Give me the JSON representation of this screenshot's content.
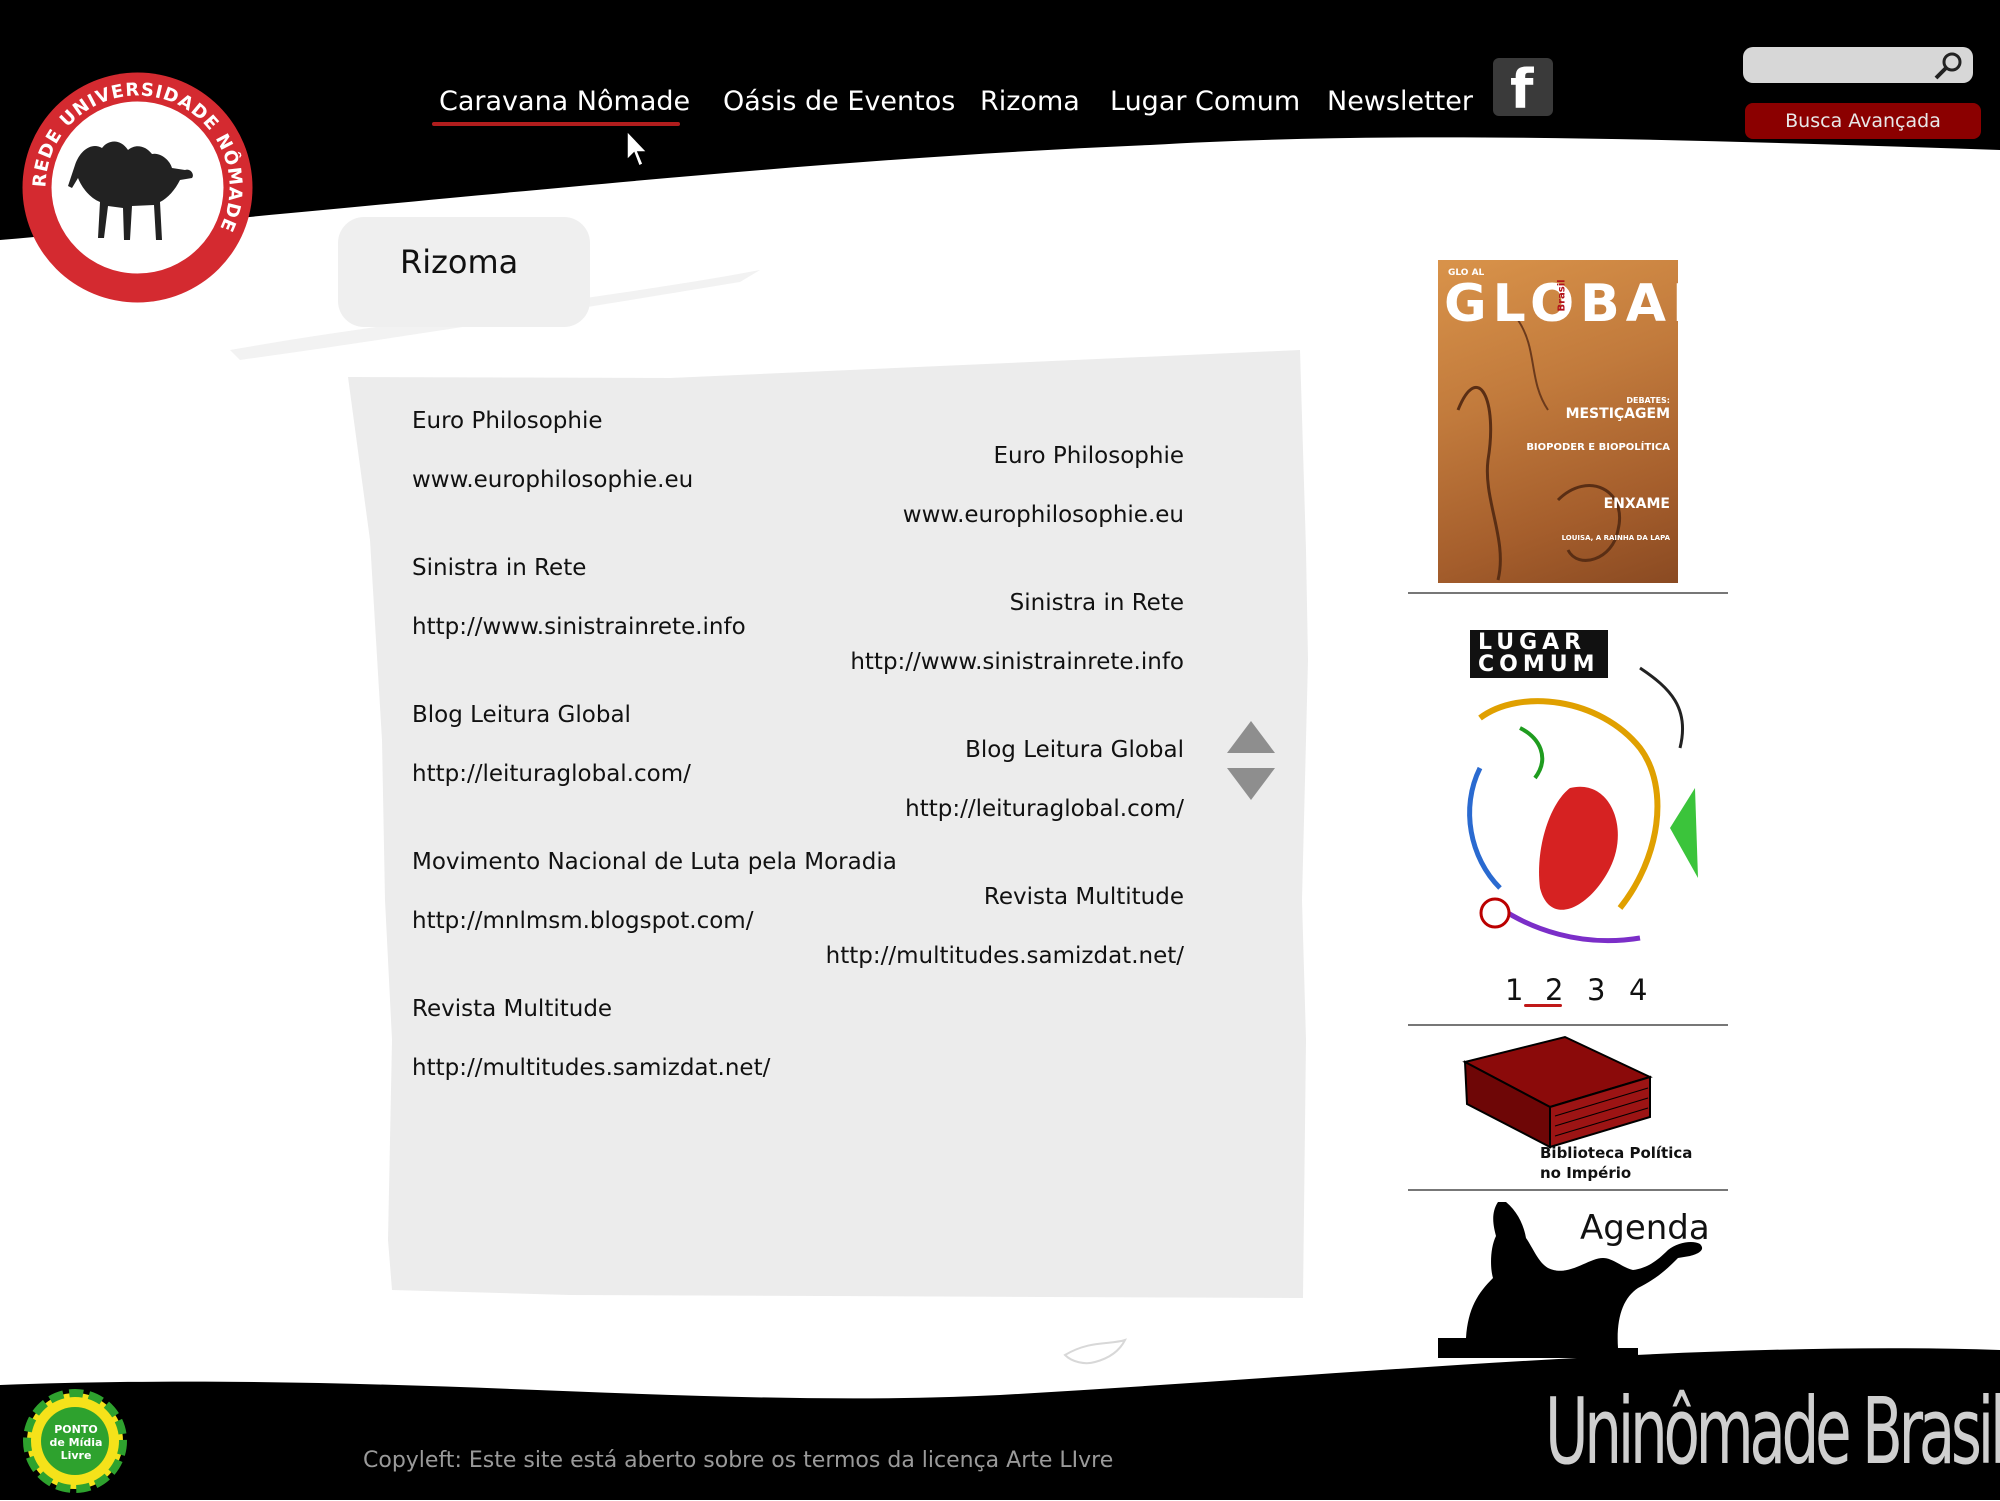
{
  "logo": {
    "ring_text": "REDE UNIVERSIDADE NÔMADE"
  },
  "nav": {
    "items": [
      "Caravana Nômade",
      "Oásis de Eventos",
      "Rizoma",
      "Lugar Comum",
      "Newsletter"
    ],
    "active": "Caravana Nômade",
    "facebook_label": "f"
  },
  "search": {
    "placeholder": "",
    "advanced_label": "Busca Avançada"
  },
  "section": {
    "title": "Rizoma"
  },
  "links_left": [
    {
      "name": "Euro Philosophie",
      "url": "www.europhilosophie.eu"
    },
    {
      "name": "Sinistra in Rete",
      "url": "http://www.sinistrainrete.info"
    },
    {
      "name": "Blog Leitura Global",
      "url": "http://leituraglobal.com/"
    },
    {
      "name": "Movimento Nacional de Luta pela Moradia",
      "url": "http://mnlmsm.blogspot.com/"
    },
    {
      "name": "Revista Multitude",
      "url": "http://multitudes.samizdat.net/"
    }
  ],
  "links_right": [
    {
      "name": "Euro Philosophie",
      "url": "www.europhilosophie.eu"
    },
    {
      "name": "Sinistra in Rete",
      "url": "http://www.sinistrainrete.info"
    },
    {
      "name": "Blog Leitura Global",
      "url": "http://leituraglobal.com/"
    },
    {
      "name": "Revista Multitude",
      "url": "http://multitudes.samizdat.net/"
    }
  ],
  "sidebar": {
    "global_cover": {
      "small_title": "GLO AL",
      "title": "GLOBAL",
      "subtitle": "Brasil",
      "headlines": [
        "DEBATES:",
        "MESTIÇAGEM",
        "BIOPODER E BIOPOLÍTICA",
        "ENXAME",
        "LOUISA, A RAINHA DA LAPA"
      ]
    },
    "lugar_comum_cover": {
      "line1": "LUGAR",
      "line2": "COMUM"
    },
    "pagination": [
      "1",
      "2",
      "3",
      "4"
    ],
    "pagination_active": "2",
    "library": {
      "line1": "Biblioteca Política",
      "line2": "no Império"
    },
    "agenda": {
      "label": "Agenda"
    }
  },
  "footer": {
    "badge_text": "PONTO de Mídia Livre",
    "copyleft": "Copyleft: Este site está aberto sobre os termos da licença Arte LIvre",
    "brand": "Uninômade Brasil"
  },
  "colors": {
    "header_bg": "#000000",
    "accent_red": "#8b0000",
    "logo_red": "#d42a30",
    "panel_grey": "#ececec"
  }
}
